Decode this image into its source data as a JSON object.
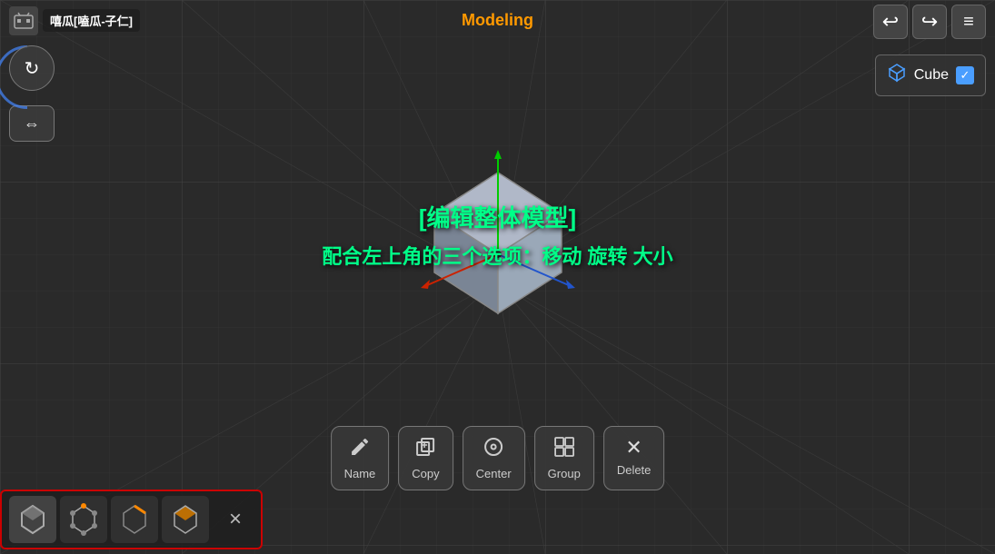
{
  "header": {
    "title": "嘻瓜[嗑瓜-子仁]",
    "mode_label": "Modeling"
  },
  "top_right": {
    "undo_label": "↩",
    "redo_label": "↪",
    "menu_label": "≡"
  },
  "object_panel": {
    "icon": "🗂",
    "cube_label": "Cube",
    "checked": "✓"
  },
  "center_text": {
    "line1": "[编辑整体模型]",
    "line2": "配合左上角的三个选项：移动 旋转 大小"
  },
  "toolbar": {
    "buttons": [
      {
        "icon": "✏",
        "label": "Name"
      },
      {
        "icon": "⊞",
        "label": "Copy"
      },
      {
        "icon": "◎",
        "label": "Center"
      },
      {
        "icon": "⊡",
        "label": "Group"
      },
      {
        "icon": "✕",
        "label": "Delete"
      }
    ]
  },
  "bottom_modes": [
    {
      "label": "object-mode-icon"
    },
    {
      "label": "vertex-mode-icon"
    },
    {
      "label": "edge-mode-icon"
    },
    {
      "label": "face-mode-icon"
    }
  ],
  "close_btn": "×"
}
